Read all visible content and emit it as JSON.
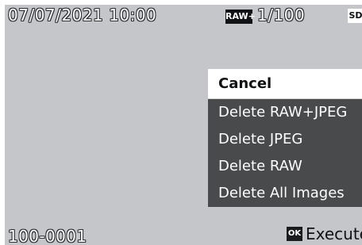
{
  "status": {
    "datetime": "07/07/2021 10:00",
    "file_format_badge": "RAW+",
    "shot_count": "1/100",
    "storage_badge": "SD"
  },
  "menu": {
    "items": [
      {
        "label": "Cancel",
        "selected": true
      },
      {
        "label": "Delete RAW+JPEG",
        "selected": false
      },
      {
        "label": "Delete JPEG",
        "selected": false
      },
      {
        "label": "Delete RAW",
        "selected": false
      },
      {
        "label": "Delete All Images",
        "selected": false
      }
    ]
  },
  "footer": {
    "file_number": "100-0001",
    "ok_button": "OK",
    "execute_label": "Execute"
  },
  "colors": {
    "preview_background": "#c5c6c9",
    "menu_item_background": "#494a4c",
    "selected_item_background": "#ffffff",
    "text_dark": "#111214",
    "text_light": "#ffffff"
  },
  "icons": {
    "format": "raw-plus-badge-icon",
    "storage": "sd-card-icon",
    "confirm": "ok-button-icon"
  }
}
